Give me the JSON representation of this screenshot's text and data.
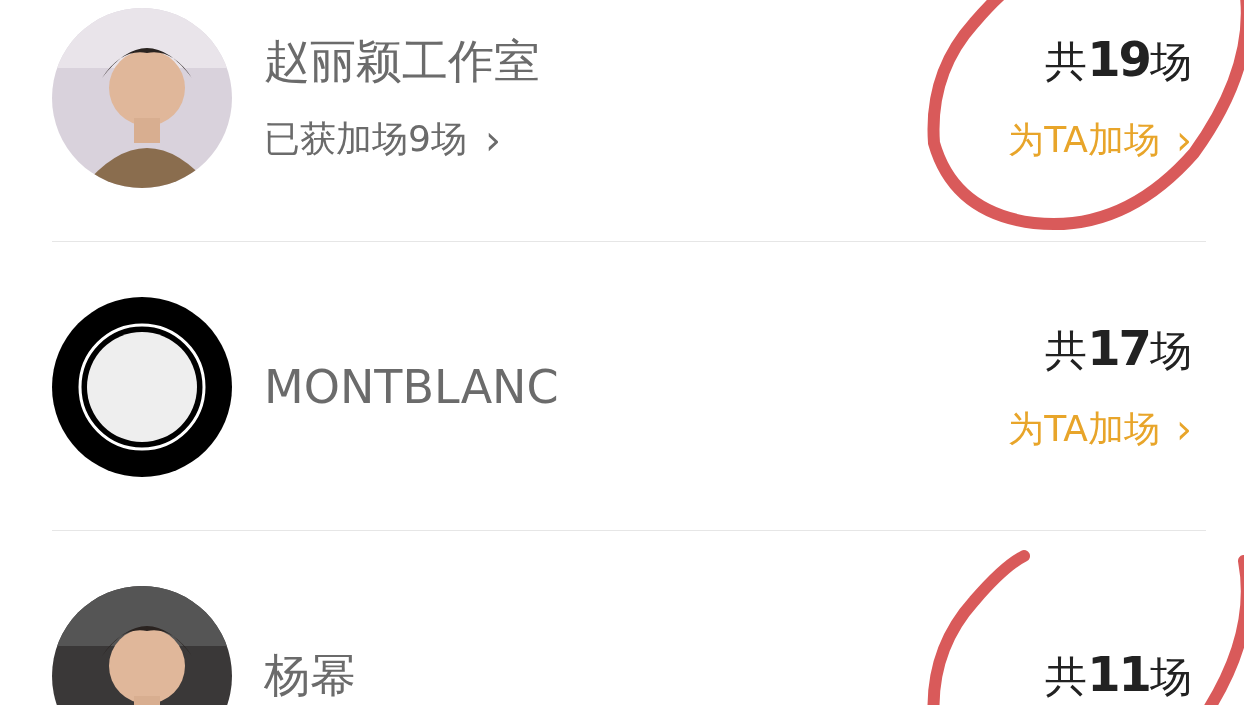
{
  "rows": [
    {
      "name": "赵丽颖工作室",
      "subtitle": "已获加场9场",
      "chevron": "›",
      "count": "共**19**场",
      "action": "为TA加场",
      "action_chevron": "›",
      "circled": true
    },
    {
      "avatar": {
        "kind": "logo"
      },
      "name": "MONTBLANC",
      "count": "共**17**场",
      "action": "为TA加场",
      "action_chevron": "›",
      "circled": false
    },
    {
      "name": "杨幂",
      "count": "共**11**场",
      "circled": true
    }
  ]
}
